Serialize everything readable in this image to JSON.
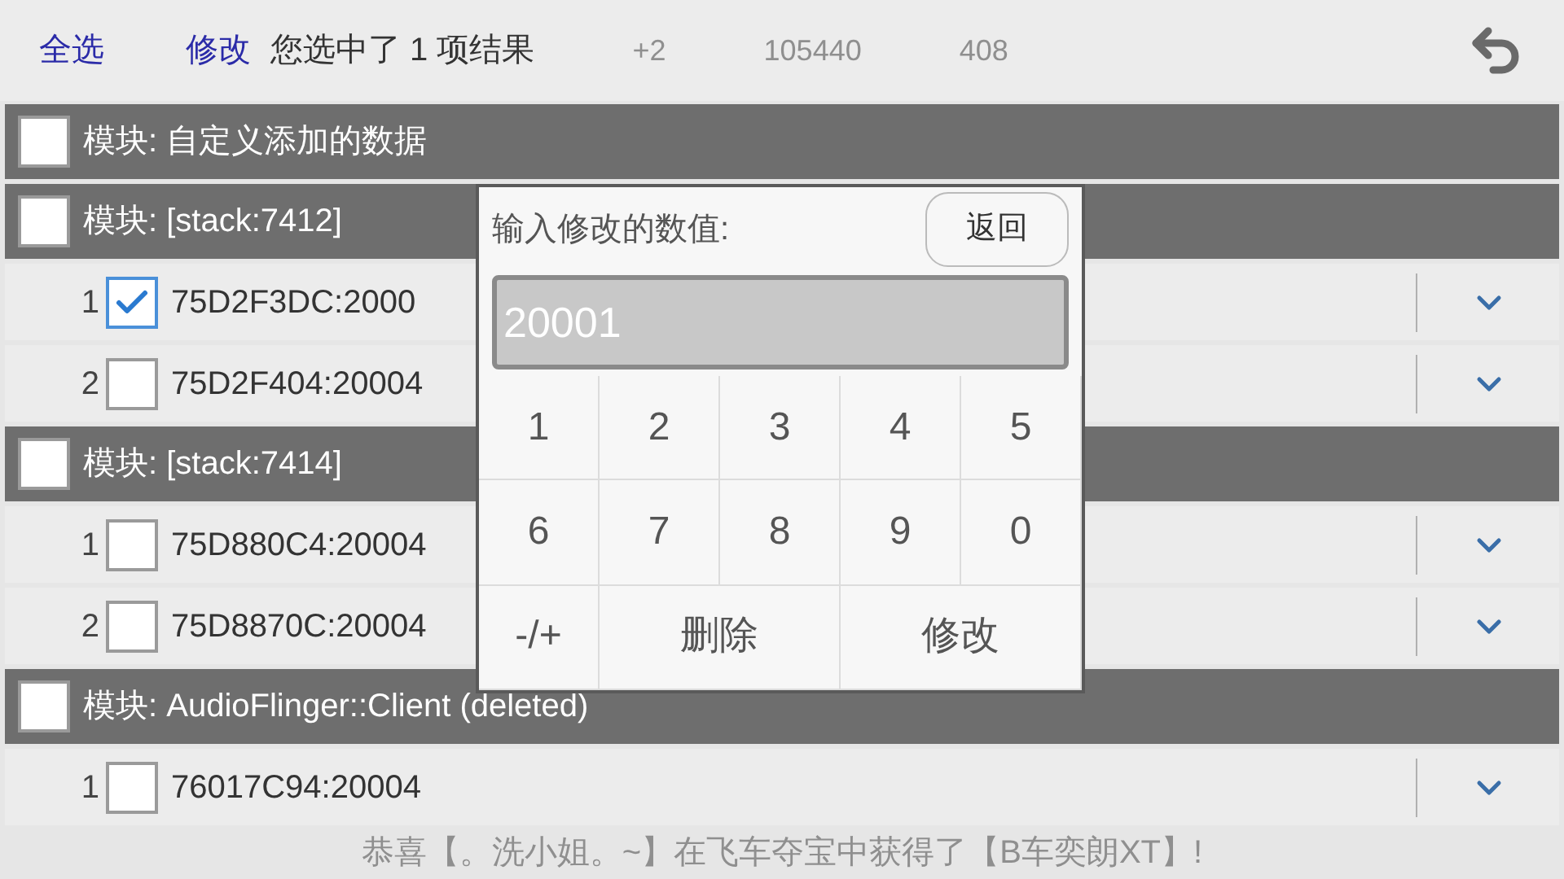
{
  "toolbar": {
    "select_all": "全选",
    "modify": "修改",
    "status": "您选中了 1 项结果"
  },
  "background_game": {
    "stats": [
      "+2",
      "105440",
      "408"
    ],
    "banner": "恭喜【。洗小姐。~】在飞车夺宝中获得了【B车奕朗XT】!"
  },
  "modules": [
    {
      "title": "模块: 自定义添加的数据",
      "checked": false
    },
    {
      "title": "模块: [stack:7412]",
      "checked": false,
      "items": [
        {
          "index": "1",
          "address": "75D2F3DC:2000",
          "checked": true
        },
        {
          "index": "2",
          "address": "75D2F404:20004",
          "checked": false
        }
      ]
    },
    {
      "title": "模块: [stack:7414]",
      "checked": false,
      "items": [
        {
          "index": "1",
          "address": "75D880C4:20004",
          "checked": false
        },
        {
          "index": "2",
          "address": "75D8870C:20004",
          "checked": false
        }
      ]
    },
    {
      "title": "模块: AudioFlinger::Client (deleted)",
      "checked": false,
      "items": [
        {
          "index": "1",
          "address": "76017C94:20004",
          "checked": false
        }
      ]
    }
  ],
  "dialog": {
    "prompt": "输入修改的数值:",
    "back_button": "返回",
    "value": "20001",
    "keys": [
      {
        "label": "1",
        "kind": "key"
      },
      {
        "label": "2",
        "kind": "key"
      },
      {
        "label": "3",
        "kind": "key"
      },
      {
        "label": "4",
        "kind": "key"
      },
      {
        "label": "5",
        "kind": "key"
      },
      {
        "label": "6",
        "kind": "key"
      },
      {
        "label": "7",
        "kind": "key"
      },
      {
        "label": "8",
        "kind": "key"
      },
      {
        "label": "9",
        "kind": "key"
      },
      {
        "label": "0",
        "kind": "key"
      },
      {
        "label": "-/+",
        "kind": "key"
      },
      {
        "label": "删除",
        "kind": "wide"
      },
      {
        "label": "修改",
        "kind": "wide"
      }
    ]
  }
}
